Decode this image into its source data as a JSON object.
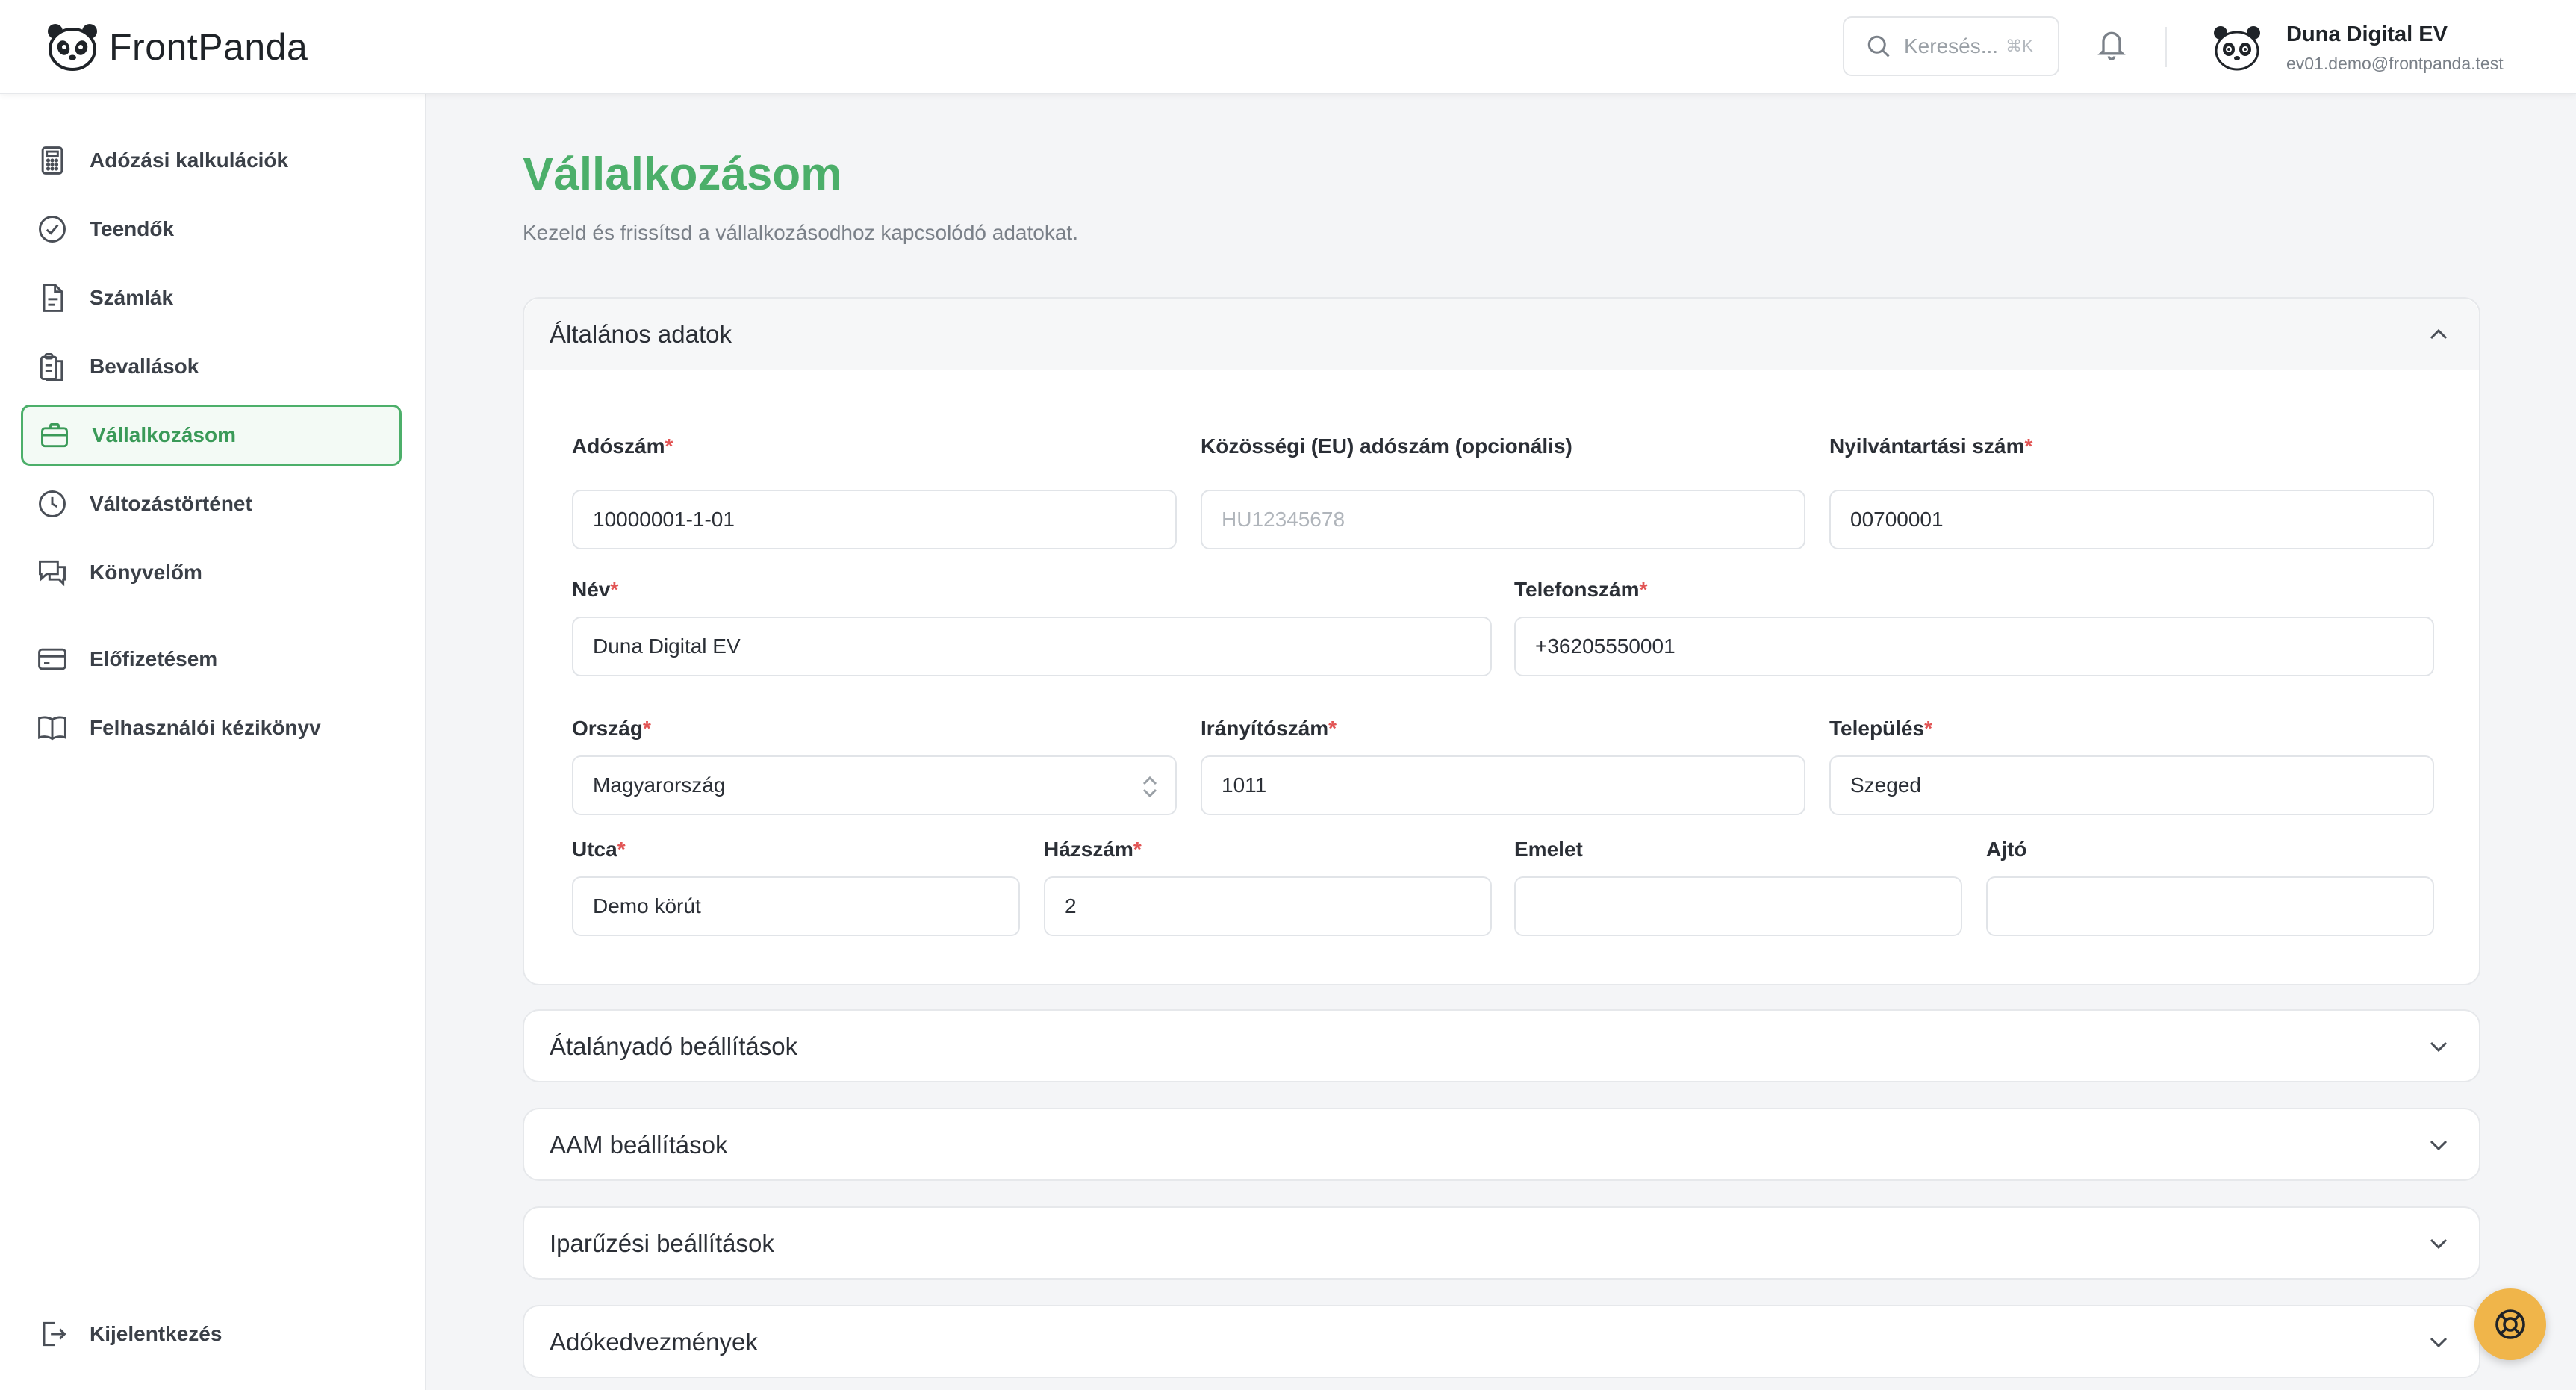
{
  "app": {
    "name": "FrontPanda"
  },
  "search": {
    "placeholder": "Keresés...",
    "shortcut": "⌘K"
  },
  "user": {
    "name": "Duna Digital EV",
    "email": "ev01.demo@frontpanda.test"
  },
  "sidebar": {
    "items": [
      {
        "label": "Adózási kalkulációk",
        "icon": "calculator-icon"
      },
      {
        "label": "Teendők",
        "icon": "check-circle-icon"
      },
      {
        "label": "Számlák",
        "icon": "invoice-icon"
      },
      {
        "label": "Bevallások",
        "icon": "clipboard-icon"
      },
      {
        "label": "Vállalkozásom",
        "icon": "briefcase-icon",
        "active": true
      },
      {
        "label": "Változástörténet",
        "icon": "clock-icon"
      },
      {
        "label": "Könyvelőm",
        "icon": "chat-icon"
      },
      {
        "label": "Előfizetésem",
        "icon": "credit-card-icon"
      },
      {
        "label": "Felhasználói kézikönyv",
        "icon": "book-icon"
      }
    ],
    "logout": {
      "label": "Kijelentkezés",
      "icon": "logout-icon"
    }
  },
  "page": {
    "title": "Vállalkozásom",
    "subtitle": "Kezeld és frissítsd a vállalkozásodhoz kapcsolódó adatokat."
  },
  "general": {
    "title": "Általános adatok",
    "fields": {
      "tax_number": {
        "label": "Adószám",
        "value": "10000001-1-01"
      },
      "eu_tax_number": {
        "label": "Közösségi (EU) adószám (opcionális)",
        "placeholder": "HU12345678"
      },
      "registration_number": {
        "label": "Nyilvántartási szám",
        "value": "00700001"
      },
      "name": {
        "label": "Név",
        "value": "Duna Digital EV"
      },
      "phone": {
        "label": "Telefonszám",
        "value": "+36205550001"
      },
      "country": {
        "label": "Ország",
        "value": "Magyarország"
      },
      "zip": {
        "label": "Irányítószám",
        "value": "1011"
      },
      "city": {
        "label": "Település",
        "value": "Szeged"
      },
      "street": {
        "label": "Utca",
        "value": "Demo körút"
      },
      "house_number": {
        "label": "Házszám",
        "value": "2"
      },
      "floor": {
        "label": "Emelet",
        "value": ""
      },
      "door": {
        "label": "Ajtó",
        "value": ""
      }
    },
    "required_mark": "*"
  },
  "sections": [
    {
      "title": "Átalányadó beállítások"
    },
    {
      "title": "AAM beállítások"
    },
    {
      "title": "Iparűzési beállítások"
    },
    {
      "title": "Adókedvezmények"
    }
  ]
}
